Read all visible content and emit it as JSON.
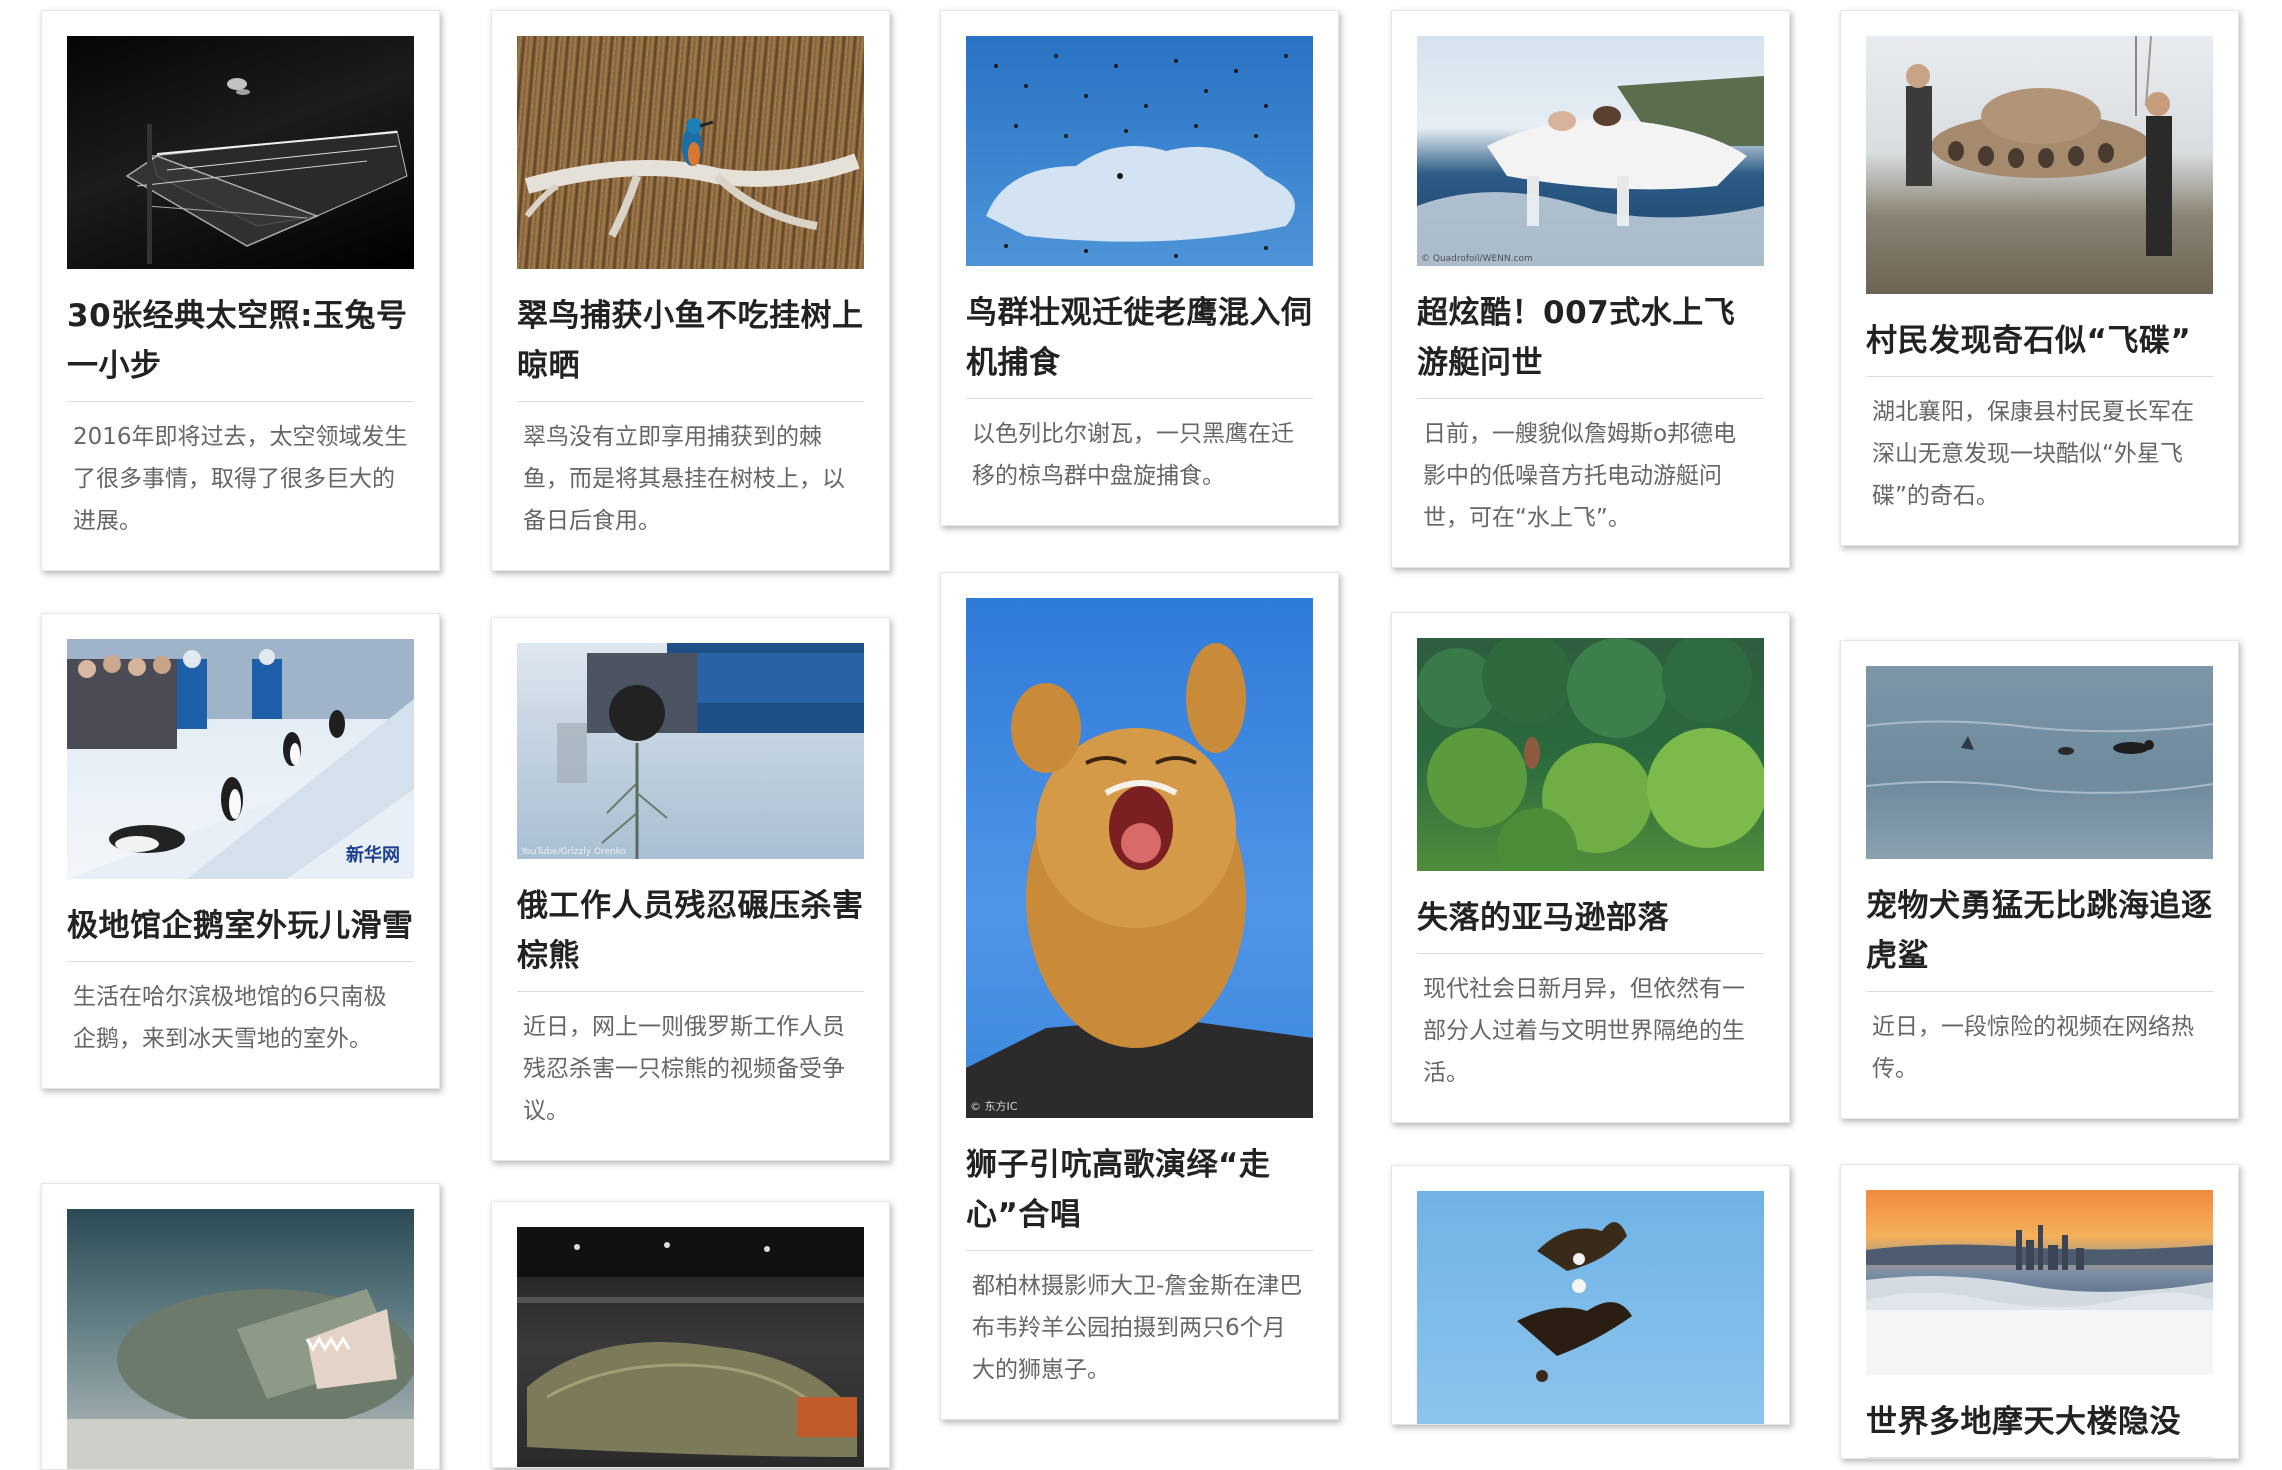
{
  "cards": [
    {
      "title": "30张经典太空照:玉兔号一小步",
      "desc": "2016年即将过去，太空领域发生了很多事情，取得了很多巨大的进展。",
      "image": "lunar rover on moon surface night photo"
    },
    {
      "title": "翠鸟捕获小鱼不吃挂树上晾晒",
      "desc": "翠鸟没有立即享用捕获到的棘鱼，而是将其悬挂在树枝上，以备日后食用。",
      "image": "kingfisher on branch with reeds"
    },
    {
      "title": "鸟群壮观迁徙老鹰混入伺机捕食",
      "desc": "以色列比尔谢瓦，一只黑鹰在迁移的椋鸟群中盘旋捕食。",
      "image": "starling flock over blue sky"
    },
    {
      "title": "超炫酷！007式水上飞游艇问世",
      "desc": "日前，一艘貌似詹姆斯o邦德电影中的低噪音方托电动游艇问世，可在“水上飞”。",
      "image": "hydrofoil boat on water",
      "caption": "© Quadrofoil/WENN.com"
    },
    {
      "title": "村民发现奇石似“飞碟”",
      "desc": "湖北襄阳，保康县村民夏长军在深山无意发现一块酷似“外星飞碟”的奇石。",
      "image": "villagers beside ufo shaped rock"
    },
    {
      "title": "极地馆企鹅室外玩儿滑雪",
      "desc": "生活在哈尔滨极地馆的6只南极企鹅，来到冰天雪地的室外。",
      "image": "penguins sliding on snow",
      "logo": "新华网"
    },
    {
      "title": "俄工作人员残忍碾压杀害棕熊",
      "desc": "近日，网上一则俄罗斯工作人员残忍杀害一只棕熊的视频备受争议。",
      "image": "truck in snowy forest",
      "caption": "YouTube/Grizzly Orenko"
    },
    {
      "title": "狮子引吭高歌演绎“走心”合唱",
      "desc": "都柏林摄影师大卫-詹金斯在津巴布韦羚羊公园拍摄到两只6个月大的狮崽子。",
      "image": "lion cub roaring against blue sky",
      "caption": "© 东方IC"
    },
    {
      "title": "失落的亚马逊部落",
      "desc": "现代社会日新月异，但依然有一部分人过着与文明世界隔绝的生活。",
      "image": "amazon rainforest trees"
    },
    {
      "title": "宠物犬勇猛无比跳海追逐虎鲨",
      "desc": "近日，一段惊险的视频在网络热传。",
      "image": "dog chasing shark in sea"
    },
    {
      "title": "",
      "desc": "",
      "image": "crocodile underwater"
    },
    {
      "title": "",
      "desc": "",
      "image": "jade burial suit in museum"
    },
    {
      "title": "",
      "desc": "",
      "image": "two eagles fighting in sky"
    },
    {
      "title": "世界多地摩天大楼隐没",
      "desc": "",
      "image": "city skyline above sea of clouds at sunset"
    }
  ]
}
